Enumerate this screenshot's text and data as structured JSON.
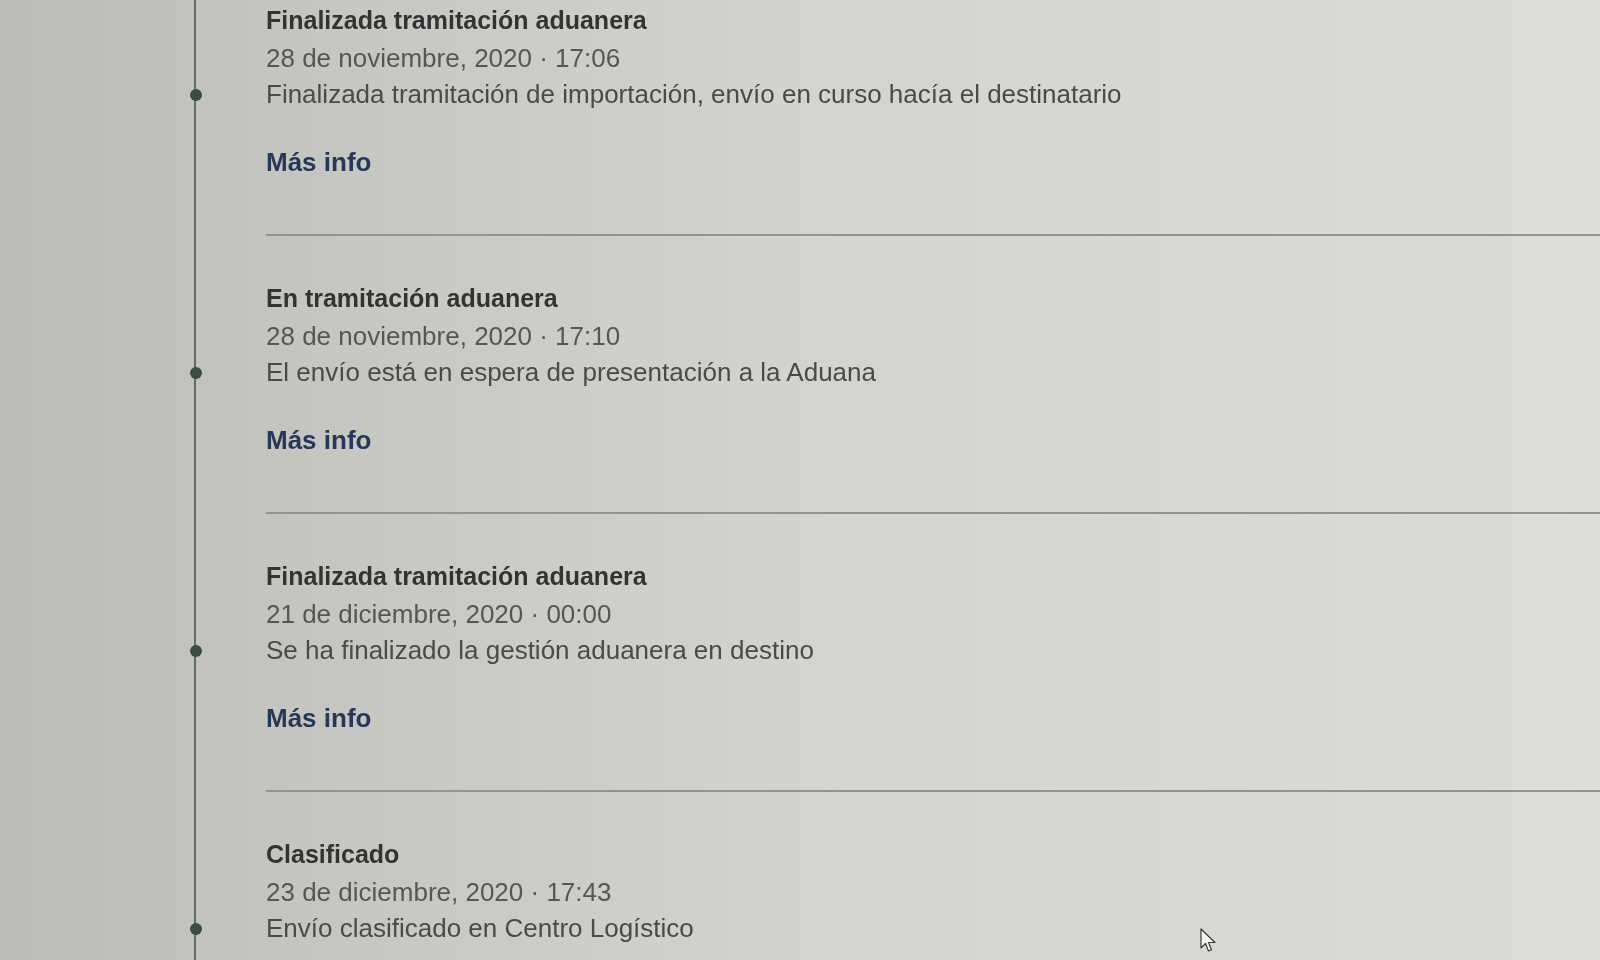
{
  "timeline": {
    "events": [
      {
        "title": "Finalizada tramitación aduanera",
        "date": "28 de noviembre, 2020 · 17:06",
        "description": "Finalizada tramitación de importación, envío en curso hacía el destinatario",
        "link": "Más info"
      },
      {
        "title": "En tramitación aduanera",
        "date": "28 de noviembre, 2020 · 17:10",
        "description": "El envío está en espera de presentación a la Aduana",
        "link": "Más info"
      },
      {
        "title": "Finalizada tramitación aduanera",
        "date": "21 de diciembre, 2020 · 00:00",
        "description": "Se ha finalizado la gestión aduanera en destino",
        "link": "Más info"
      },
      {
        "title": "Clasificado",
        "date": "23 de diciembre, 2020 · 17:43",
        "description": "Envío clasificado en Centro Logístico"
      }
    ]
  }
}
